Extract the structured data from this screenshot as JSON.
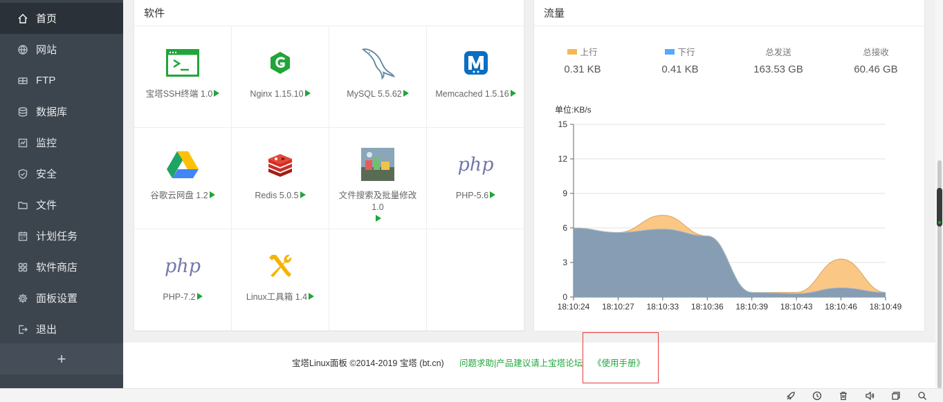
{
  "sidebar": {
    "items": [
      {
        "label": "首页",
        "icon": "home-icon"
      },
      {
        "label": "网站",
        "icon": "globe-icon"
      },
      {
        "label": "FTP",
        "icon": "ftp-icon"
      },
      {
        "label": "数据库",
        "icon": "database-icon"
      },
      {
        "label": "监控",
        "icon": "monitor-icon"
      },
      {
        "label": "安全",
        "icon": "shield-icon"
      },
      {
        "label": "文件",
        "icon": "folder-icon"
      },
      {
        "label": "计划任务",
        "icon": "calendar-icon"
      },
      {
        "label": "软件商店",
        "icon": "apps-grid-icon"
      },
      {
        "label": "面板设置",
        "icon": "gear-icon"
      },
      {
        "label": "退出",
        "icon": "logout-icon"
      }
    ],
    "add_label": "+"
  },
  "software": {
    "title": "软件",
    "items": [
      {
        "name": "宝塔SSH终端 1.0",
        "icon": "terminal-icon"
      },
      {
        "name": "Nginx 1.15.10",
        "icon": "nginx-logo-icon"
      },
      {
        "name": "MySQL 5.5.62",
        "icon": "mysql-dolphin-icon"
      },
      {
        "name": "Memcached 1.5.16",
        "icon": "memcached-logo-icon"
      },
      {
        "name": "谷歌云网盘 1.2",
        "icon": "google-drive-icon"
      },
      {
        "name": "Redis 5.0.5",
        "icon": "redis-logo-icon"
      },
      {
        "name": "文件搜索及批量修改 1.0",
        "icon": "file-search-thumbnail-icon"
      },
      {
        "name": "PHP-5.6",
        "icon": "php-logo-icon",
        "logo_text": "php"
      },
      {
        "name": "PHP-7.2",
        "icon": "php-logo-icon",
        "logo_text": "php"
      },
      {
        "name": "Linux工具箱 1.4",
        "icon": "toolbox-icon"
      }
    ]
  },
  "traffic": {
    "title": "流量",
    "stats": [
      {
        "label": "上行",
        "value": "0.31 KB",
        "color": "#f7b851"
      },
      {
        "label": "下行",
        "value": "0.41 KB",
        "color": "#52a9ff"
      },
      {
        "label": "总发送",
        "value": "163.53 GB"
      },
      {
        "label": "总接收",
        "value": "60.46 GB"
      }
    ]
  },
  "chart_data": {
    "type": "area",
    "ylabel": "单位:KB/s",
    "ylim": [
      0,
      15
    ],
    "yticks": [
      "0",
      "3",
      "6",
      "9",
      "12",
      "15"
    ],
    "x": [
      "18:10:24",
      "18:10:27",
      "18:10:33",
      "18:10:36",
      "18:10:39",
      "18:10:43",
      "18:10:46",
      "18:10:49"
    ],
    "grid": true,
    "series": [
      {
        "name": "上行",
        "color": "#f7b851",
        "values": [
          6.0,
          5.6,
          7.1,
          5.3,
          0.4,
          0.4,
          3.3,
          0.4
        ]
      },
      {
        "name": "下行",
        "color": "#52a9ff",
        "values": [
          6.0,
          5.6,
          5.9,
          5.3,
          0.4,
          0.3,
          0.8,
          0.4
        ]
      }
    ]
  },
  "footer": {
    "copyright": "宝塔Linux面板 ©2014-2019 宝塔 (bt.cn)",
    "forum_link": "问题求助|产品建议请上宝塔论坛",
    "manual_link": "《使用手册》"
  },
  "taskbar": {
    "icons": [
      "rocket-icon",
      "clock-icon",
      "trash-icon",
      "speaker-icon",
      "window-icon",
      "search-icon"
    ]
  }
}
